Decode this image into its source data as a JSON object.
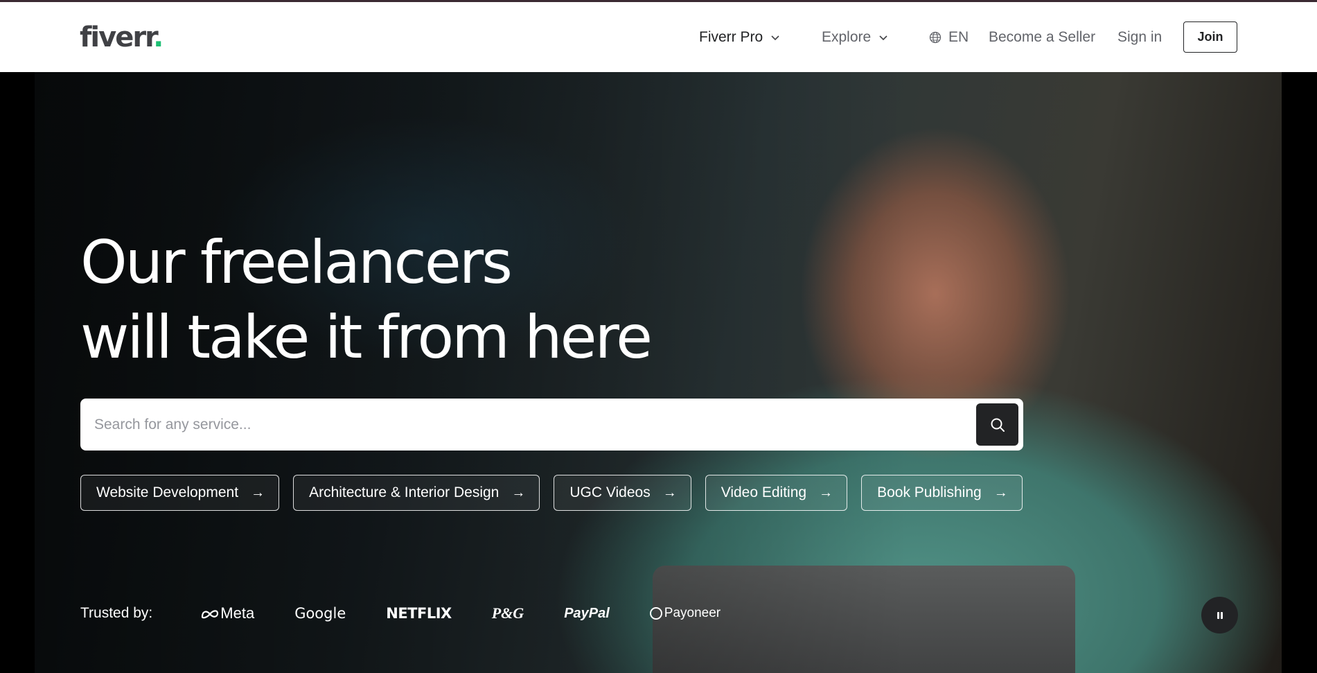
{
  "header": {
    "logo_text": "fiverr",
    "logo_dot": ".",
    "nav": {
      "fiverr_pro": "Fiverr Pro",
      "explore": "Explore",
      "language": "EN",
      "become_seller": "Become a Seller",
      "sign_in": "Sign in",
      "join": "Join"
    }
  },
  "hero": {
    "title_line1": "Our freelancers",
    "title_line2": "will take it from here",
    "search": {
      "placeholder": "Search for any service..."
    },
    "chips": [
      {
        "label": "Website Development"
      },
      {
        "label": "Architecture & Interior Design"
      },
      {
        "label": "UGC Videos"
      },
      {
        "label": "Video Editing"
      },
      {
        "label": "Book Publishing"
      }
    ],
    "trusted": {
      "label": "Trusted by:",
      "brands": [
        "Meta",
        "Google",
        "NETFLIX",
        "P&G",
        "PayPal",
        "Payoneer"
      ]
    }
  },
  "colors": {
    "brand_green": "#1dbf73",
    "text_dark": "#222325",
    "text_muted": "#62646a"
  },
  "icons": [
    "chevron-down-icon",
    "globe-icon",
    "search-icon",
    "arrow-right-icon",
    "pause-icon",
    "meta-icon",
    "payoneer-icon"
  ]
}
